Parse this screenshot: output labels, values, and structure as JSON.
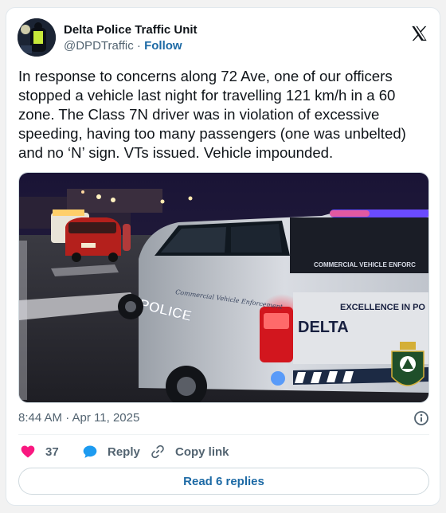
{
  "author": {
    "display_name": "Delta Police Traffic Unit",
    "handle": "@DPDTraffic",
    "separator": "·",
    "follow_label": "Follow"
  },
  "tweet": {
    "text": "In response to concerns along 72 Ave, one of our officers stopped a vehicle last night for travelling 121 km/h in a 60 zone. The Class 7N driver was in violation of excessive speeding, having too many passengers (one was unbelted) and no ‘N’ sign. VTs issued. Vehicle impounded."
  },
  "media": {
    "vehicle_text": {
      "brand": "DELTA",
      "police": "POLICE",
      "cve_banner": "COMMERCIAL VEHICLE ENFORC",
      "tagline": "EXCELLENCE IN PO",
      "side_script": "Commercial Vehicle Enforcement"
    }
  },
  "meta": {
    "timestamp": "8:44 AM · Apr 11, 2025"
  },
  "actions": {
    "like_count": "37",
    "reply_label": "Reply",
    "copy_label": "Copy link"
  },
  "footer": {
    "read_replies_label": "Read 6 replies"
  },
  "colors": {
    "link": "#1d6aa5",
    "like": "#f91880",
    "reply_icon": "#1d9bf0",
    "secondary_text": "#536471"
  },
  "icons": {
    "logo": "x-logo-icon",
    "info": "info-icon",
    "like": "heart-icon",
    "reply": "speech-bubble-icon",
    "copy": "link-icon"
  }
}
